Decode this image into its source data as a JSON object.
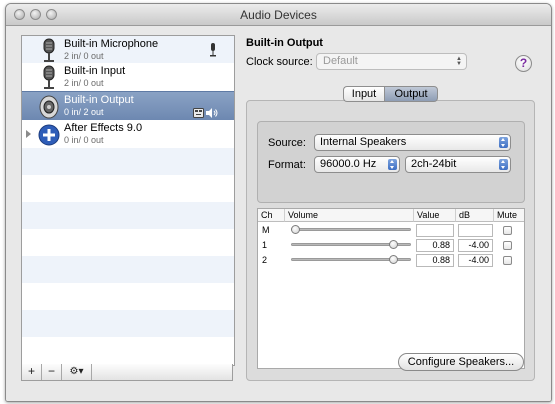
{
  "window": {
    "title": "Audio Devices"
  },
  "devices": [
    {
      "name": "Built-in Microphone",
      "io": "2 in/ 0 out",
      "icon": "microphone-icon",
      "badge": "mic-icon"
    },
    {
      "name": "Built-in Input",
      "io": "2 in/ 0 out",
      "icon": "microphone-icon"
    },
    {
      "name": "Built-in Output",
      "io": "0 in/ 2 out",
      "icon": "speaker-icon",
      "badges": [
        "finder-icon",
        "speaker-volume-icon"
      ],
      "selected": true
    },
    {
      "name": "After Effects 9.0",
      "io": "0 in/ 0 out",
      "icon": "plus-circle-icon"
    }
  ],
  "list_toolbar": {
    "add": "+",
    "remove": "−",
    "gear": "⚙▾"
  },
  "detail": {
    "title": "Built-in Output",
    "clock_label": "Clock source:",
    "clock_value": "Default",
    "help": "?",
    "tabs": [
      "Input",
      "Output"
    ],
    "active_tab": "Output",
    "source_label": "Source:",
    "source_value": "Internal Speakers",
    "format_label": "Format:",
    "format_rate": "96000.0 Hz",
    "format_bits": "2ch-24bit",
    "table": {
      "headers": {
        "ch": "Ch",
        "volume": "Volume",
        "value": "Value",
        "db": "dB",
        "mute": "Mute"
      },
      "rows": [
        {
          "ch": "M",
          "value": "",
          "db": "",
          "level": 0.0
        },
        {
          "ch": "1",
          "value": "0.88",
          "db": "-4.00",
          "level": 0.88
        },
        {
          "ch": "2",
          "value": "0.88",
          "db": "-4.00",
          "level": 0.88
        }
      ]
    },
    "configure_button": "Configure Speakers..."
  },
  "colors": {
    "selection": "#7591bb",
    "accent_popup": "#3d6fc4",
    "help_mark": "#7a2aa0"
  }
}
